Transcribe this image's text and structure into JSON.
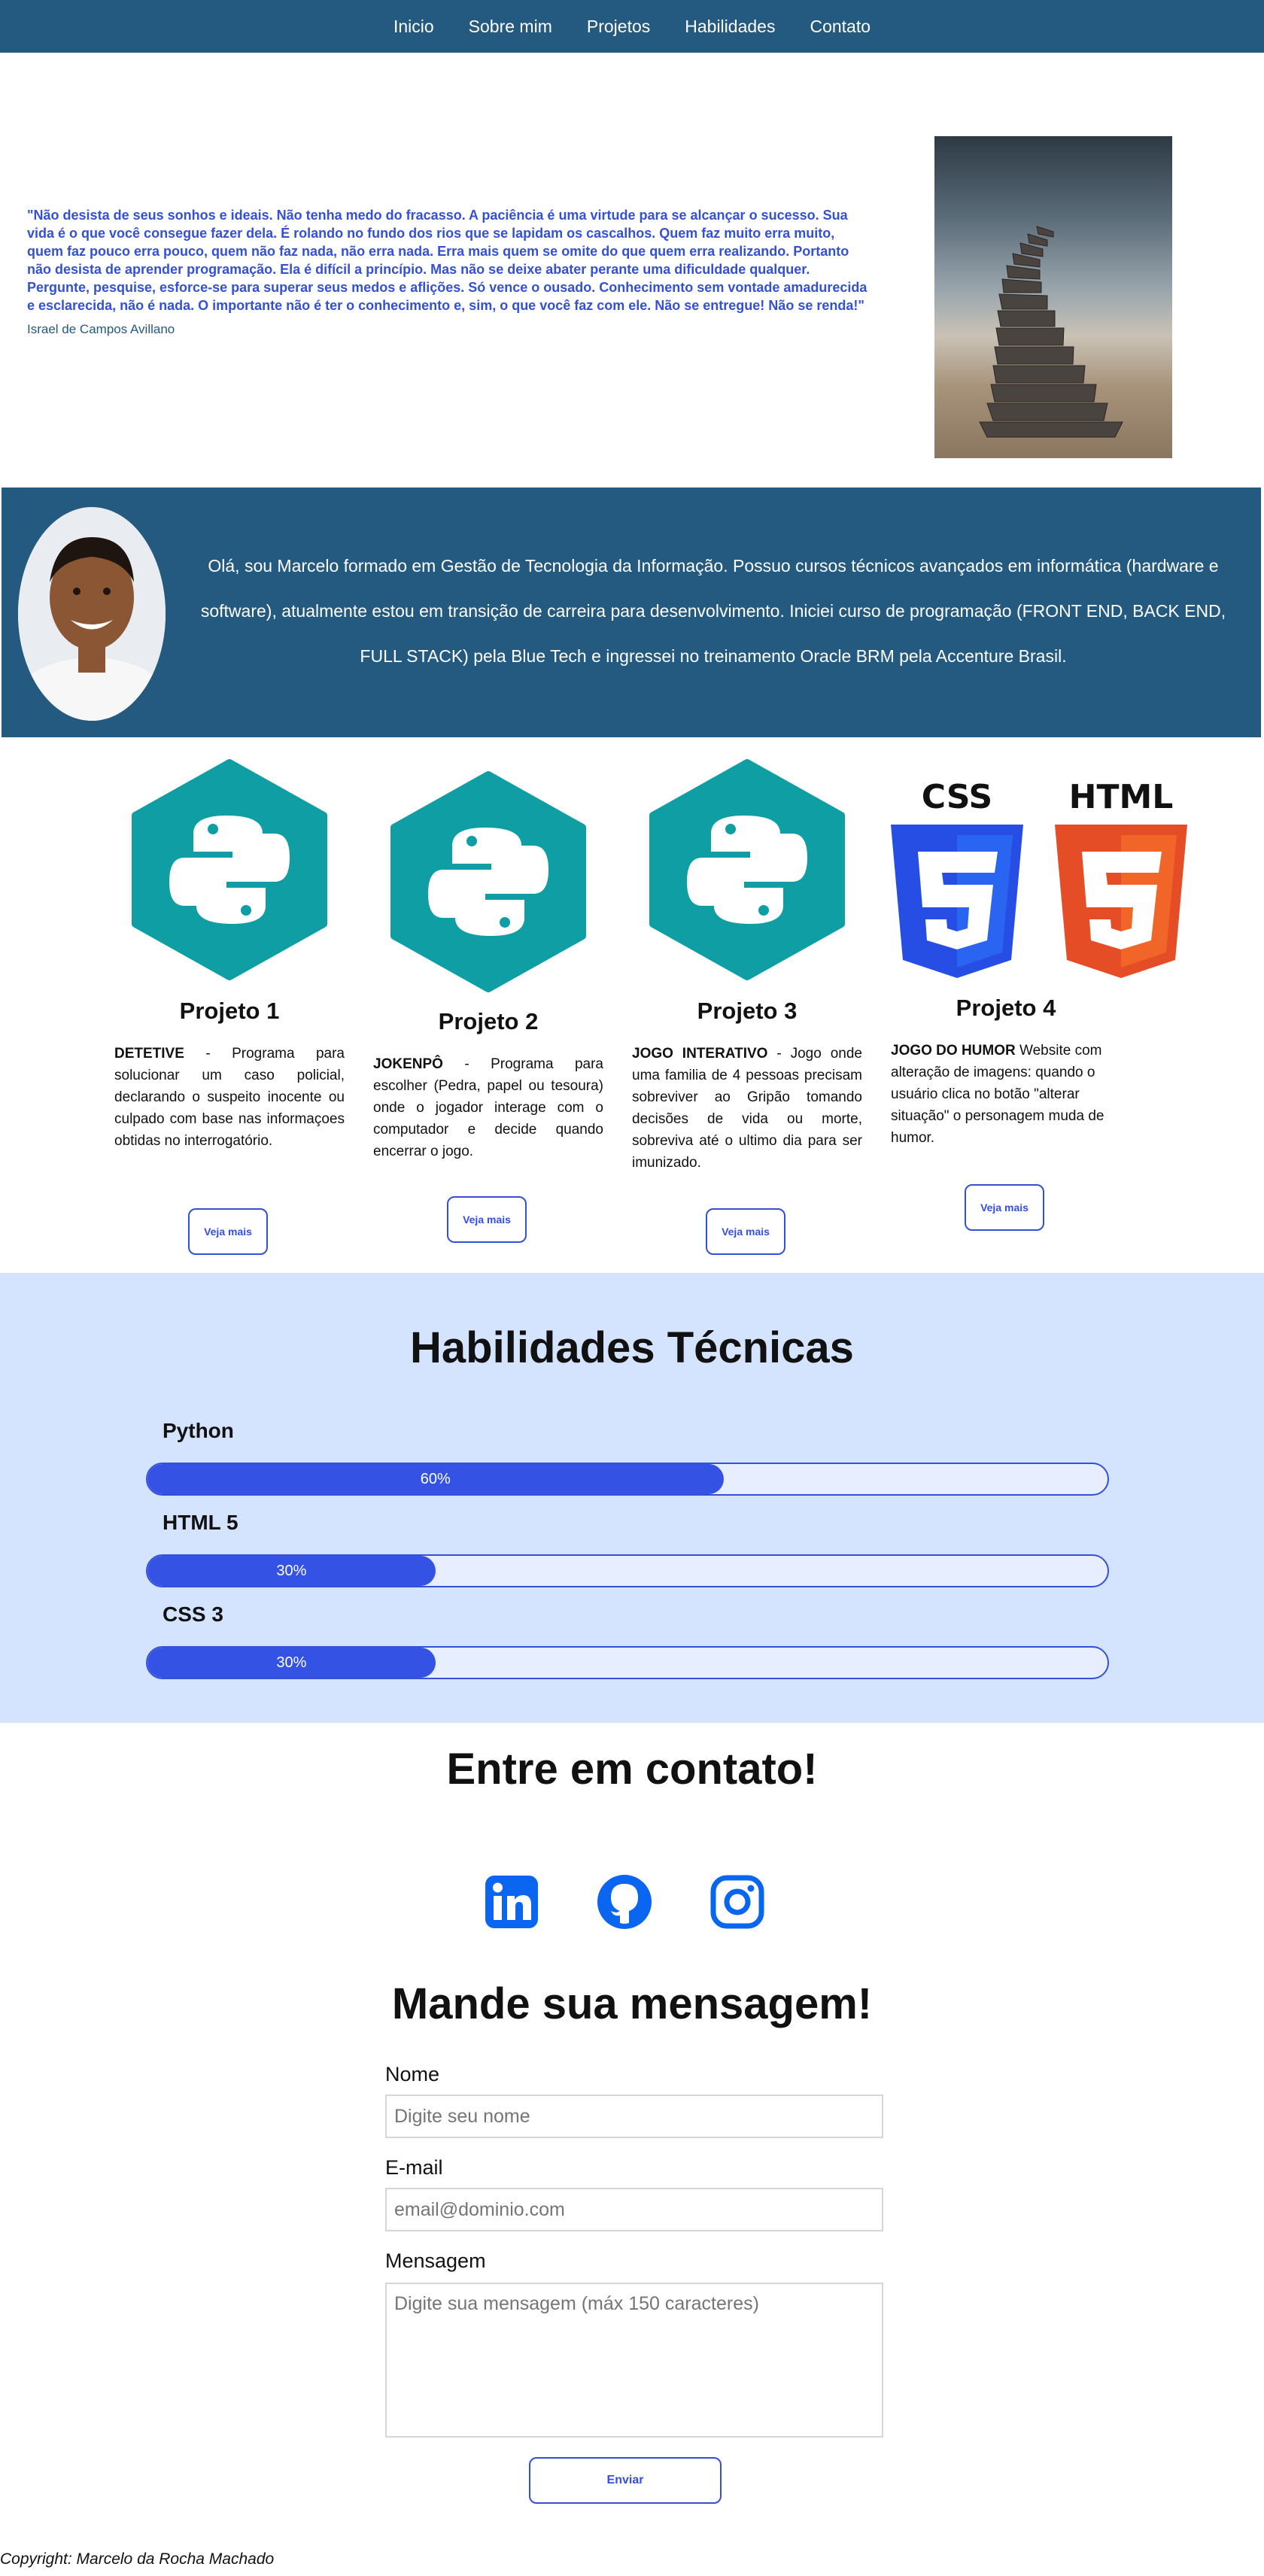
{
  "nav": {
    "items": [
      {
        "label": "Inicio"
      },
      {
        "label": "Sobre mim"
      },
      {
        "label": "Projetos"
      },
      {
        "label": "Habilidades"
      },
      {
        "label": "Contato"
      }
    ]
  },
  "quote": {
    "text": "\"Não desista de seus sonhos e ideais. Não tenha medo do fracasso. A paciência é uma virtude para se alcançar o sucesso. Sua vida é o que você consegue fazer dela. É rolando no fundo dos rios que se lapidam os cascalhos. Quem faz muito erra muito, quem faz pouco erra pouco, quem não faz nada, não erra nada. Erra mais quem se omite do que quem erra realizando. Portanto não desista de aprender programação. Ela é difícil a princípio. Mas não se deixe abater perante uma dificuldade qualquer. Pergunte, pesquise, esforce-se para superar seus medos e aflições. Só vence o ousado. Conhecimento sem vontade amadurecida e esclarecida, não é nada. O importante não é ter o conhecimento e, sim, o que você faz com ele. Não se entregue! Não se renda!\"",
    "author": "Israel de Campos Avillano"
  },
  "about": {
    "text": "Olá, sou Marcelo formado em Gestão de Tecnologia da Informação. Possuo cursos técnicos avançados em informática (hardware e software), atualmente estou em transição de carreira para desenvolvimento. Iniciei curso de programação (FRONT END, BACK END, FULL STACK) pela Blue Tech e ingressei no treinamento Oracle BRM pela Accenture Brasil."
  },
  "projects": [
    {
      "title": "Projeto 1",
      "name": "DETETIVE",
      "desc": " - Programa para solucionar um caso policial, declarando o suspeito inocente ou culpado com base nas informaçoes obtidas no interrogatório.",
      "button": "Veja mais",
      "icon": "python-icon"
    },
    {
      "title": "Projeto 2",
      "name": "JOKENPÔ",
      "desc": " - Programa para escolher (Pedra, papel ou tesoura) onde o jogador interage com o computador e decide quando encerrar o jogo.",
      "button": "Veja mais",
      "icon": "python-icon"
    },
    {
      "title": "Projeto 3",
      "name": "JOGO INTERATIVO",
      "desc": " - Jogo onde uma familia de 4 pessoas precisam sobreviver ao Gripão tomando decisões de vida ou morte, sobreviva até o ultimo dia para ser imunizado.",
      "button": "Veja mais",
      "icon": "python-icon"
    },
    {
      "title": "Projeto 4",
      "name": "JOGO DO HUMOR",
      "desc": " Website com alteração de imagens: quando o usuário clica no botão \"alterar situação\" o personagem muda de humor.",
      "button": "Veja mais",
      "icon": "css-html-icon",
      "logo_css": "CSS",
      "logo_html": "HTML"
    }
  ],
  "skills": {
    "title": "Habilidades Técnicas",
    "items": [
      {
        "name": "Python",
        "percent": 60,
        "label": "60%"
      },
      {
        "name": "HTML 5",
        "percent": 30,
        "label": "30%"
      },
      {
        "name": "CSS 3",
        "percent": 30,
        "label": "30%"
      }
    ]
  },
  "contact": {
    "title": "Entre em contato!",
    "message_title": "Mande sua mensagem!",
    "name_label": "Nome",
    "name_placeholder": "Digite seu nome",
    "email_label": "E-mail",
    "email_placeholder": "email@dominio.com",
    "message_label": "Mensagem",
    "message_placeholder": "Digite sua mensagem (máx 150 caracteres)",
    "send": "Enviar"
  },
  "footer": {
    "copyright": "Copyright: Marcelo da Rocha Machado"
  },
  "colors": {
    "nav": "#245a80",
    "accent": "#3450d6",
    "skills_bg": "#d4e4ff",
    "python": "#0f9ea3"
  }
}
